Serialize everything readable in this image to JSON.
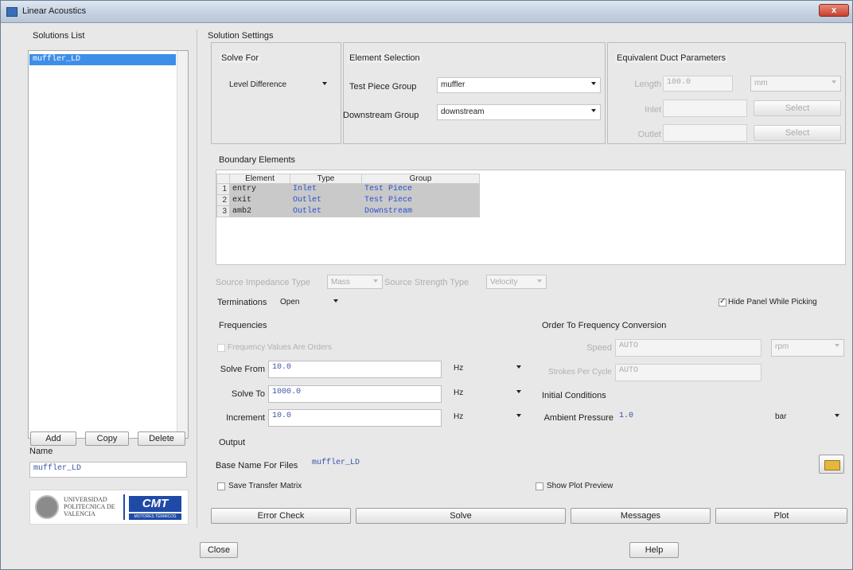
{
  "window": {
    "title": "Linear Acoustics",
    "close_glyph": "x"
  },
  "solutions_list": {
    "label": "Solutions List",
    "items": [
      "muffler_LD"
    ],
    "add_label": "Add",
    "copy_label": "Copy",
    "delete_label": "Delete",
    "name_label": "Name",
    "name_value": "muffler_LD"
  },
  "logos": {
    "upv": "UNIVERSIDAD POLITECNICA DE VALENCIA",
    "cmt": "CMT",
    "cmt_sub": "MOTORES TÉRMICOS"
  },
  "settings": {
    "title": "Solution Settings",
    "solve_for": {
      "label": "Solve For",
      "value": "Level Difference"
    },
    "element_selection": {
      "label": "Element Selection",
      "test_piece_label": "Test Piece Group",
      "test_piece_value": "muffler",
      "downstream_label": "Downstream Group",
      "downstream_value": "downstream"
    },
    "equivalent_duct": {
      "label": "Equivalent Duct Parameters",
      "length_label": "Length",
      "length_value": "100.0",
      "length_unit": "mm",
      "inlet_label": "Inlet",
      "outlet_label": "Outlet",
      "select_label": "Select"
    },
    "boundary": {
      "label": "Boundary Elements",
      "headers": [
        "Element",
        "Type",
        "Group"
      ],
      "rows": [
        {
          "num": "1",
          "element": "entry",
          "type": "Inlet",
          "group": "Test Piece"
        },
        {
          "num": "2",
          "element": "exit",
          "type": "Outlet",
          "group": "Test Piece"
        },
        {
          "num": "3",
          "element": "amb2",
          "type": "Outlet",
          "group": "Downstream"
        }
      ]
    },
    "source": {
      "impedance_label": "Source Impedance Type",
      "impedance_value": "Mass",
      "strength_label": "Source Strength Type",
      "strength_value": "Velocity"
    },
    "terminations": {
      "label": "Terminations",
      "value": "Open"
    },
    "hide_panel": {
      "label": "Hide Panel While Picking",
      "checked": true
    },
    "frequencies": {
      "label": "Frequencies",
      "orders_label": "Frequency Values Are Orders",
      "solve_from_label": "Solve From",
      "solve_from_value": "10.0",
      "solve_from_unit": "Hz",
      "solve_to_label": "Solve To",
      "solve_to_value": "1000.0",
      "solve_to_unit": "Hz",
      "increment_label": "Increment",
      "increment_value": "10.0",
      "increment_unit": "Hz"
    },
    "order_conversion": {
      "label": "Order To Frequency Conversion",
      "speed_label": "Speed",
      "speed_value": "AUTO",
      "speed_unit": "rpm",
      "strokes_label": "Strokes Per Cycle",
      "strokes_value": "AUTO"
    },
    "initial_conditions": {
      "label": "Initial Conditions",
      "ambient_label": "Ambient Pressure",
      "ambient_value": "1.0",
      "ambient_unit": "bar"
    },
    "output": {
      "label": "Output",
      "base_name_label": "Base Name For Files",
      "base_name_value": "muffler_LD",
      "save_transfer_label": "Save Transfer Matrix",
      "show_plot_label": "Show Plot Preview"
    },
    "actions": {
      "error_check": "Error Check",
      "solve": "Solve",
      "messages": "Messages",
      "plot": "Plot"
    }
  },
  "footer": {
    "close": "Close",
    "help": "Help"
  }
}
